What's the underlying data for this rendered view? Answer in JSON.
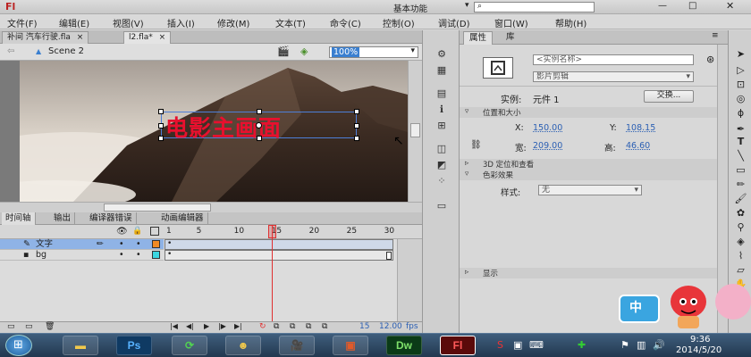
{
  "app": {
    "logo": "Fl",
    "workspace": "基本功能",
    "search_placeholder": ""
  },
  "menu": [
    "文件(F)",
    "编辑(E)",
    "视图(V)",
    "插入(I)",
    "修改(M)",
    "文本(T)",
    "命令(C)",
    "控制(O)",
    "调试(D)",
    "窗口(W)",
    "帮助(H)"
  ],
  "doc_tabs": [
    "补间 汽车行驶.fla",
    "l2.fla*"
  ],
  "edit_bar": {
    "scene": "Scene 2",
    "zoom": "100%"
  },
  "stage": {
    "text": "电影主画面",
    "text_color": "#e8102e"
  },
  "timeline": {
    "tabs": [
      "时间轴",
      "输出",
      "编译器错误",
      "动画编辑器"
    ],
    "frame_numbers": [
      "1",
      "5",
      "10",
      "15",
      "20",
      "25",
      "30"
    ],
    "layers": [
      {
        "name": "文字",
        "color": "#f08a24",
        "selected": true
      },
      {
        "name": "bg",
        "color": "#3cd6e0",
        "selected": false
      }
    ],
    "current_frame": "15",
    "fps": "12.00",
    "fps_unit": "fps",
    "playhead_color": "#e03030"
  },
  "properties": {
    "tabs": [
      "属性",
      "库"
    ],
    "instance_name_placeholder": "<实例名称>",
    "symbol_type": "影片剪辑",
    "instance_label": "实例:",
    "instance_value": "元件 1",
    "swap_button": "交换...",
    "section_position": "位置和大小",
    "x_label": "X:",
    "x_value": "150.00",
    "y_label": "Y:",
    "y_value": "108.15",
    "w_label": "宽:",
    "w_value": "209.00",
    "h_label": "高:",
    "h_value": "46.60",
    "section_3d": "3D 定位和查看",
    "section_color": "色彩效果",
    "style_label": "样式:",
    "style_value": "无",
    "section_display": "显示"
  },
  "ime": {
    "label": "中"
  },
  "taskbar": {
    "apps": [
      "",
      "",
      "Ps",
      "",
      "",
      "",
      "",
      "Dw",
      "Fl"
    ],
    "time": "9:36",
    "date": "2014/5/20"
  },
  "colors": {
    "accent": "#3a7fd0",
    "selected_layer": "#8fb3e6"
  }
}
